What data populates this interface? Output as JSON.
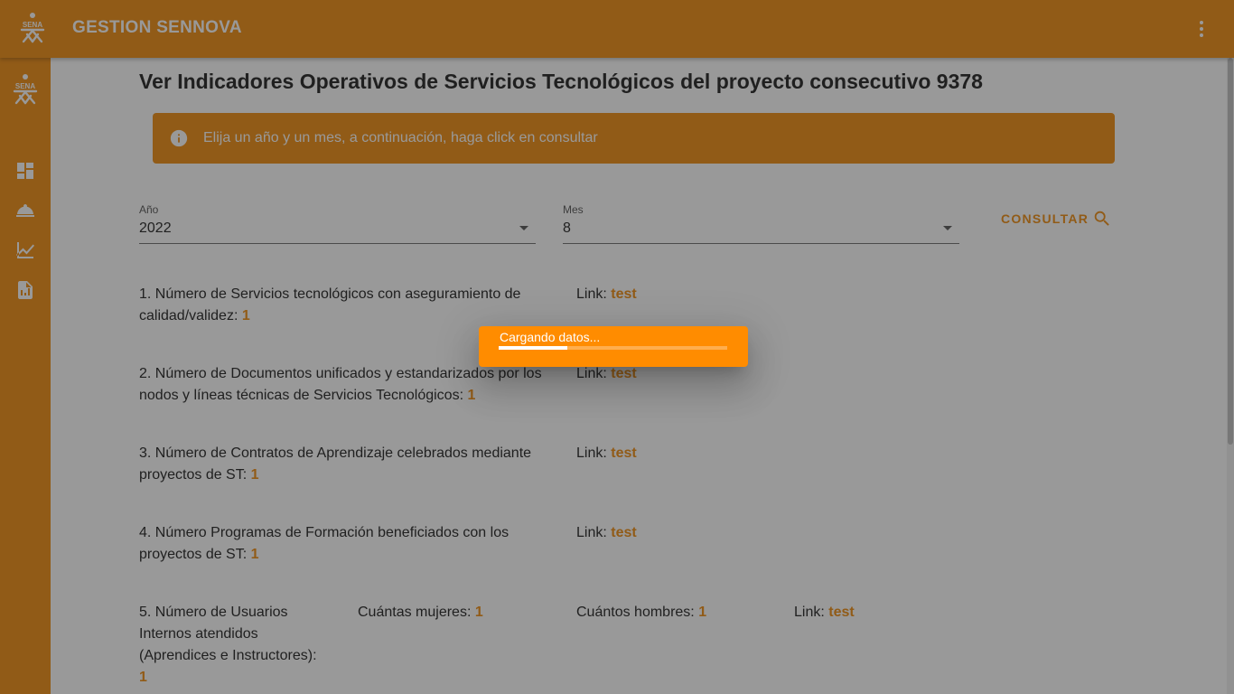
{
  "appbar": {
    "title": "GESTION SENNOVA",
    "logo_text": "SENA",
    "menu_icon": "more-vert-icon"
  },
  "sidebar": {
    "logo_text": "SENA",
    "items": [
      {
        "icon": "dashboard-icon"
      },
      {
        "icon": "room-service-icon"
      },
      {
        "icon": "timeline-icon"
      },
      {
        "icon": "report-icon"
      }
    ]
  },
  "page": {
    "title": "Ver Indicadores Operativos de Servicios Tecnológicos del proyecto consecutivo 9378"
  },
  "alert": {
    "icon": "info-icon",
    "text": "Elija un año y un mes, a continuación, haga click en consultar"
  },
  "filters": {
    "year": {
      "label": "Año",
      "value": "2022"
    },
    "month": {
      "label": "Mes",
      "value": "8"
    },
    "consultar_label": "CONSULTAR"
  },
  "indicators": [
    {
      "text": "1. Número de Servicios tecnológicos con aseguramiento de calidad/validez:",
      "value": "1",
      "link_label": "Link:",
      "link_text": "test"
    },
    {
      "text": "2. Número de Documentos unificados y estandarizados por los nodos y líneas técnicas de Servicios Tecnológicos:",
      "value": "1",
      "link_label": "Link:",
      "link_text": "test"
    },
    {
      "text": "3. Número de Contratos de Aprendizaje celebrados mediante proyectos de ST:",
      "value": "1",
      "link_label": "Link:",
      "link_text": "test"
    },
    {
      "text": "4. Número Programas de Formación beneficiados con los proyectos de ST:",
      "value": "1",
      "link_label": "Link:",
      "link_text": "test"
    },
    {
      "text": "5. Número de Usuarios Internos atendidos (Aprendices e Instructores):",
      "value": "1",
      "women_label": "Cuántas mujeres:",
      "women_value": "1",
      "men_label": "Cuántos hombres:",
      "men_value": "1",
      "link_label": "Link:",
      "link_text": "test"
    }
  ],
  "loading": {
    "text": "Cargando datos...",
    "progress": 0.3
  },
  "colors": {
    "primary": "#f08c10",
    "loader": "#ff8c00"
  }
}
